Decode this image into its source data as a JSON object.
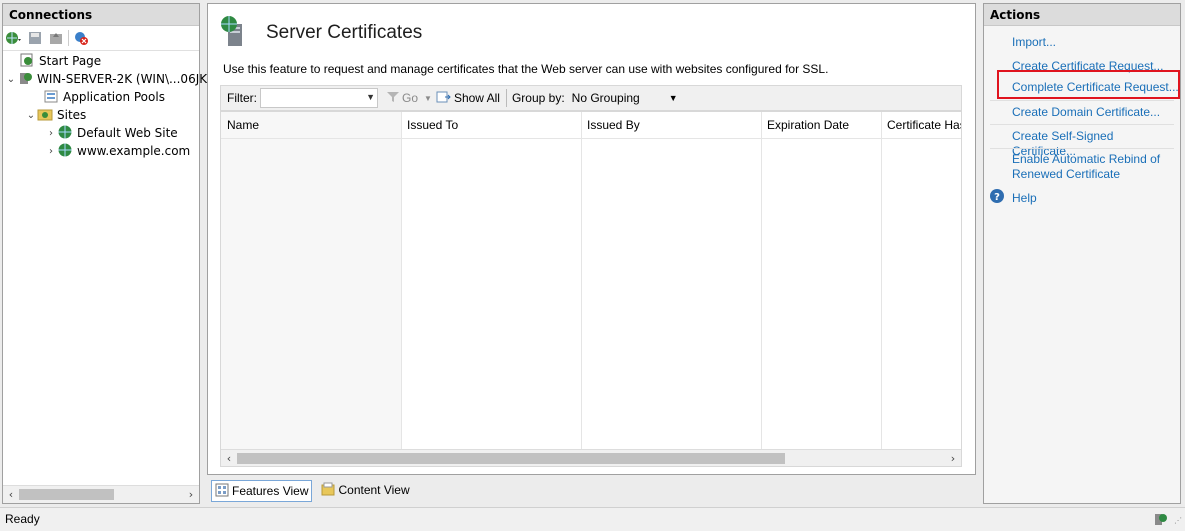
{
  "connections": {
    "title": "Connections",
    "tree": [
      {
        "label": "Start Page"
      },
      {
        "label": "WIN-SERVER-2K (WIN\\...06JK"
      },
      {
        "label": "Application Pools"
      },
      {
        "label": "Sites"
      },
      {
        "label": "Default Web Site"
      },
      {
        "label": "www.example.com"
      }
    ]
  },
  "feature": {
    "title": "Server Certificates",
    "description": "Use this feature to request and manage certificates that the Web server can use with websites configured for SSL.",
    "filter_label": "Filter:",
    "filter_value": "",
    "go_label": "Go",
    "show_all_label": "Show All",
    "group_by_label": "Group by:",
    "group_by_value": "No Grouping",
    "columns": [
      "Name",
      "Issued To",
      "Issued By",
      "Expiration Date",
      "Certificate Has"
    ]
  },
  "view_tabs": {
    "features": "Features View",
    "content": "Content View"
  },
  "actions": {
    "title": "Actions",
    "items": [
      {
        "label": "Import..."
      },
      {
        "label": "Create Certificate Request..."
      },
      {
        "label": "Complete Certificate Request..."
      },
      {
        "label": "Create Domain Certificate..."
      },
      {
        "label": "Create Self-Signed Certificate..."
      },
      {
        "label": "Enable Automatic Rebind of Renewed Certificate"
      },
      {
        "label": "Help"
      }
    ],
    "highlight_color": "#e0141e",
    "link_color": "#1a6fb8"
  },
  "status": {
    "text": "Ready"
  }
}
